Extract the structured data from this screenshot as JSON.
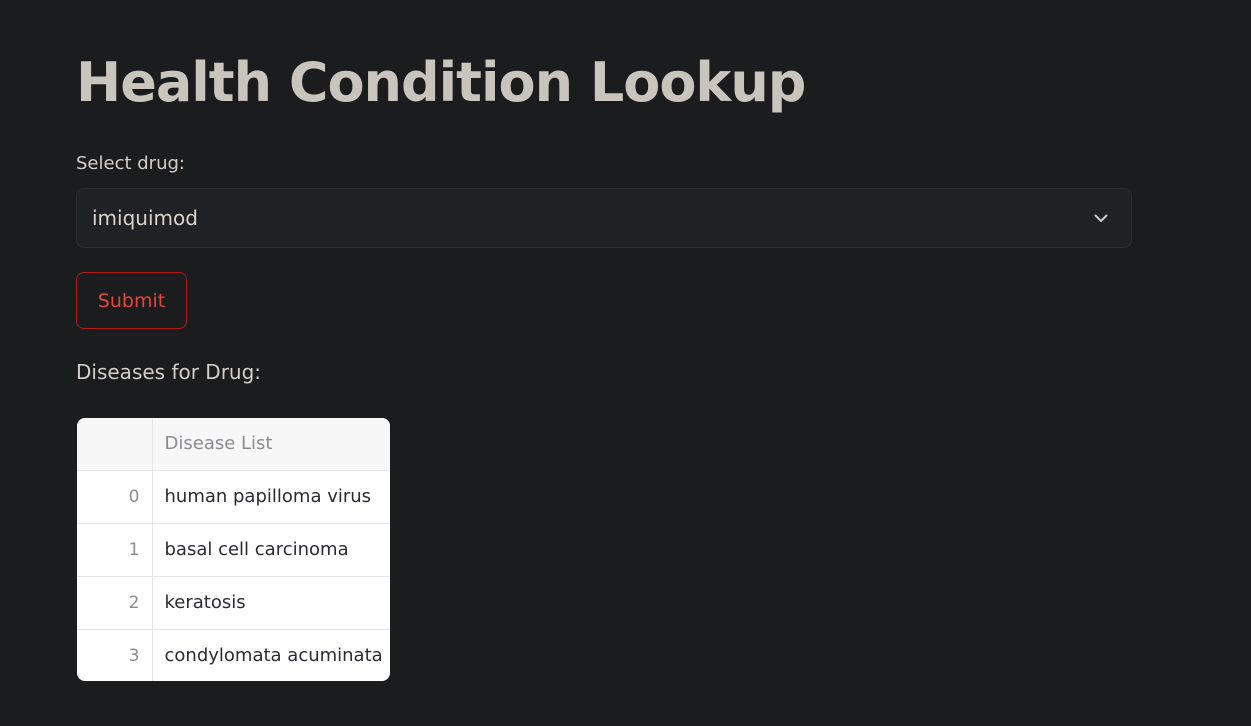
{
  "page": {
    "title": "Health Condition Lookup"
  },
  "form": {
    "select_label": "Select drug:",
    "selected_drug": "imiquimod",
    "submit_label": "Submit"
  },
  "results": {
    "heading": "Diseases for Drug:",
    "table": {
      "index_header": "",
      "column_header": "Disease List",
      "rows": [
        {
          "index": "0",
          "value": "human papilloma virus"
        },
        {
          "index": "1",
          "value": "basal cell carcinoma"
        },
        {
          "index": "2",
          "value": "keratosis"
        },
        {
          "index": "3",
          "value": "condylomata acuminata"
        }
      ]
    }
  },
  "icons": {
    "dropdown": "chevron-down-icon"
  },
  "colors": {
    "background": "#1b1c1e",
    "accent": "#e8453c",
    "button_border": "#b31b1b"
  }
}
